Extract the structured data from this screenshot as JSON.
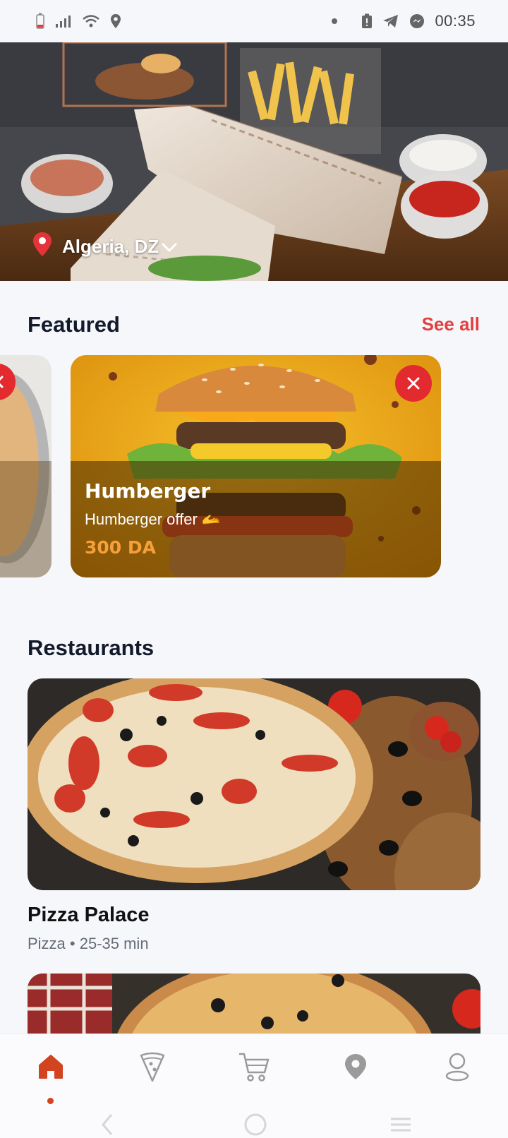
{
  "status_bar": {
    "time": "00:35",
    "icons": [
      "battery-low-icon",
      "signal-icon",
      "wifi-icon",
      "location-pin-icon",
      "dot-icon",
      "battery-alert-icon",
      "telegram-icon",
      "messenger-icon"
    ]
  },
  "hero": {
    "location": "Algeria, DZ",
    "image": "shawarma-wraps-with-fries-photo"
  },
  "featured": {
    "title": "Featured",
    "see_all": "See all",
    "cards": [
      {
        "image": "pizza-photo",
        "partial": true
      },
      {
        "name": "Humberger",
        "subtitle": "Humberger offer 🫴",
        "price": "300 DA",
        "image": "burger-photo"
      }
    ]
  },
  "restaurants": {
    "title": "Restaurants",
    "items": [
      {
        "name": "Pizza Palace",
        "meta": "Pizza • 25-35 min",
        "image": "pizza-photo"
      },
      {
        "image": "mushroom-pizza-photo"
      }
    ]
  },
  "bottom_nav": {
    "items": [
      "home-icon",
      "pizza-slice-icon",
      "cart-icon",
      "location-pin-icon",
      "profile-icon"
    ],
    "active": "home-icon",
    "accent": "#d2431f",
    "inactive": "#9a9a9a"
  },
  "colors": {
    "accent_red": "#e2403f",
    "price_orange": "#f6a03a",
    "background": "#f6f7fb"
  }
}
